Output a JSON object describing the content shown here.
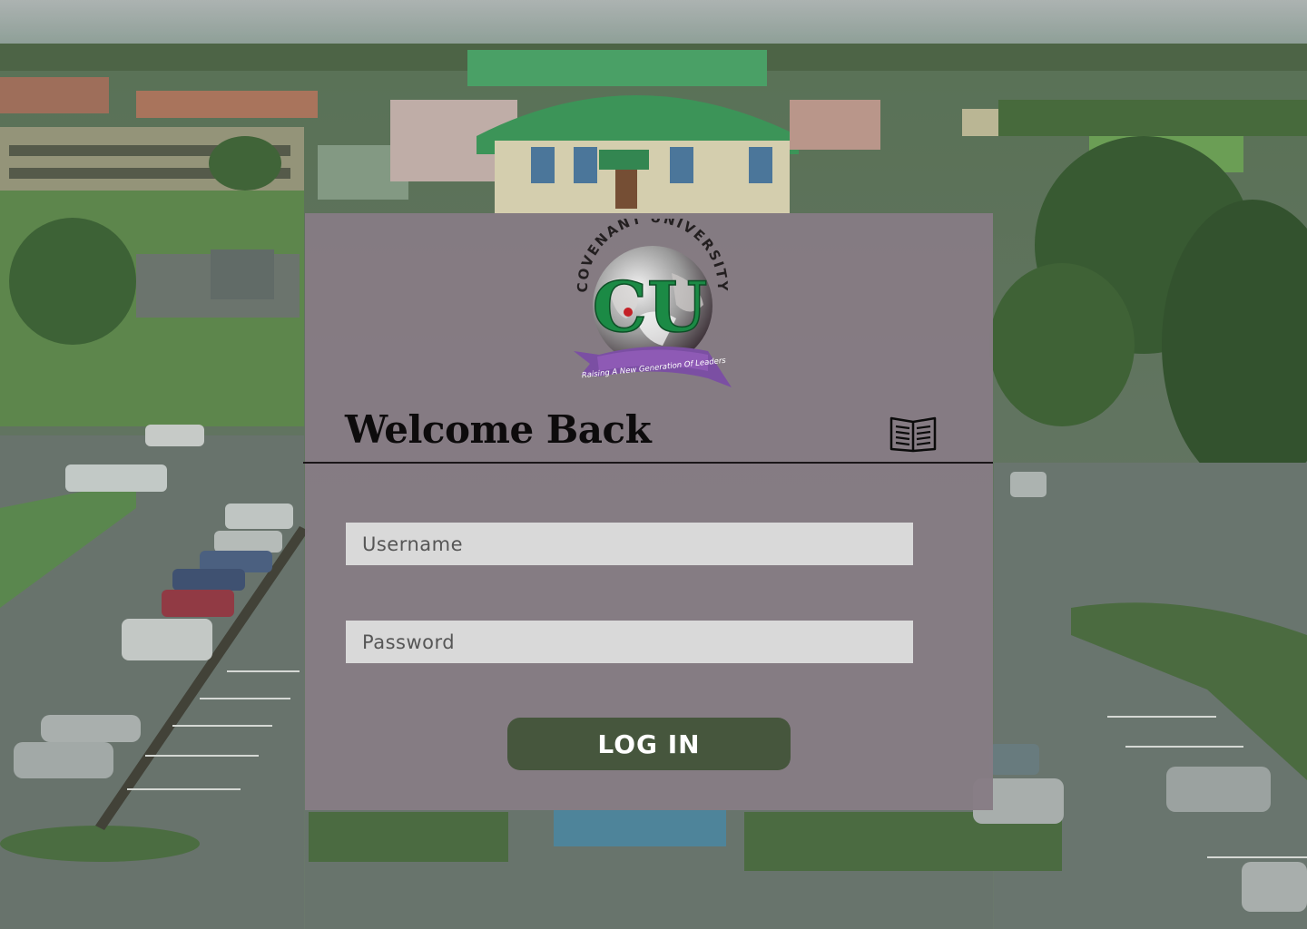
{
  "background": {
    "scene_icon": "campus-aerial-photo",
    "tint": "#4f6a4b"
  },
  "logo": {
    "icon": "university-crest-icon",
    "arc_text": "COVENANT UNIVERSITY",
    "monogram": "CU",
    "motto": "Raising A New Generation Of Leaders",
    "monogram_color": "#1b8a45",
    "ribbon_color": "#7b4fa3"
  },
  "login": {
    "title": "Welcome Back",
    "title_icon": "open-book-icon",
    "username_placeholder": "Username",
    "password_placeholder": "Password",
    "button_label": "LOG IN",
    "button_color": "#46563d"
  }
}
